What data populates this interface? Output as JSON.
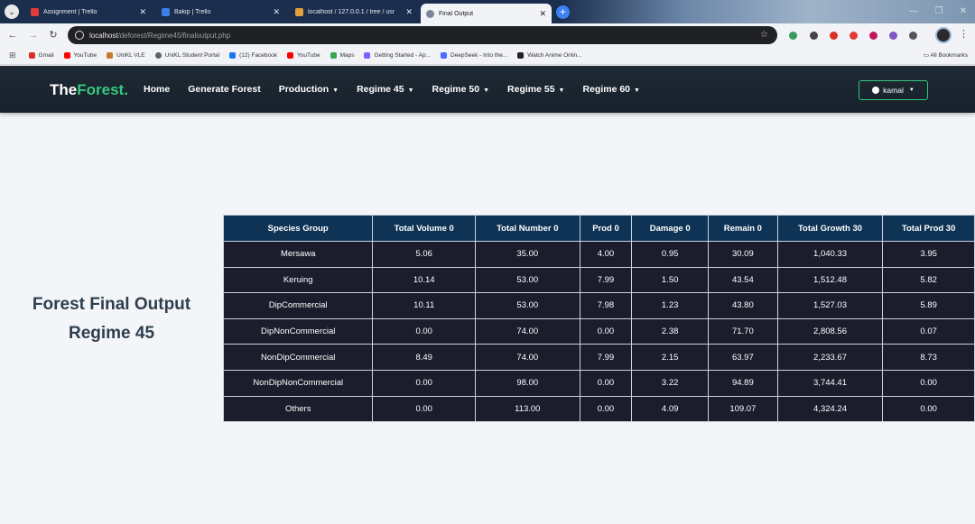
{
  "browser": {
    "tabs": [
      {
        "title": "Assignment | Trello",
        "favicon_color": "#e03c3c"
      },
      {
        "title": "Bakip | Trello",
        "favicon_color": "#3f7ee8"
      },
      {
        "title": "localhost / 127.0.0.1 / tree / usr",
        "favicon_color": "#e2a03f"
      },
      {
        "title": "Final Output",
        "favicon_color": "#7a8899"
      }
    ],
    "new_tab_label": "+",
    "url_host": "localhost",
    "url_path": "/deforest/Regime45/finaloutput.php",
    "bookmarks": [
      {
        "label": "Gmail",
        "color": "#d93025"
      },
      {
        "label": "YouTube",
        "color": "#ff0000"
      },
      {
        "label": "UniKL VLE",
        "color": "#c47a2c"
      },
      {
        "label": "UniKL Student Portal",
        "color": "#5f6368"
      },
      {
        "label": "(12) Facebook",
        "color": "#1877f2"
      },
      {
        "label": "YouTube",
        "color": "#ff0000"
      },
      {
        "label": "Maps",
        "color": "#34a853"
      },
      {
        "label": "Getting Started - Ap...",
        "color": "#7b61ff"
      },
      {
        "label": "DeepSeek - Into the...",
        "color": "#4d6bfe"
      },
      {
        "label": "Watch Anime Onlin...",
        "color": "#222222"
      }
    ],
    "all_bookmarks_label": "All Bookmarks"
  },
  "navbar": {
    "brand_main": "The",
    "brand_accent": "Forest.",
    "accent_color": "#34c97b",
    "items": [
      {
        "label": "Home",
        "dropdown": false
      },
      {
        "label": "Generate Forest",
        "dropdown": false
      },
      {
        "label": "Production",
        "dropdown": true
      },
      {
        "label": "Regime 45",
        "dropdown": true
      },
      {
        "label": "Regime 50",
        "dropdown": true
      },
      {
        "label": "Regime 55",
        "dropdown": true
      },
      {
        "label": "Regime 60",
        "dropdown": true
      }
    ],
    "user_label": "kamal"
  },
  "page": {
    "title_line1": "Forest Final Output",
    "title_line2": "Regime 45"
  },
  "table": {
    "columns": [
      "Species Group",
      "Total Volume 0",
      "Total Number 0",
      "Prod 0",
      "Damage 0",
      "Remain 0",
      "Total Growth 30",
      "Total Prod 30"
    ],
    "rows": [
      [
        "Mersawa",
        "5.06",
        "35.00",
        "4.00",
        "0.95",
        "30.09",
        "1,040.33",
        "3.95"
      ],
      [
        "Keruing",
        "10.14",
        "53.00",
        "7.99",
        "1.50",
        "43.54",
        "1,512.48",
        "5.82"
      ],
      [
        "DipCommercial",
        "10.11",
        "53.00",
        "7.98",
        "1.23",
        "43.80",
        "1,527.03",
        "5.89"
      ],
      [
        "DipNonCommercial",
        "0.00",
        "74.00",
        "0.00",
        "2.38",
        "71.70",
        "2,808.56",
        "0.07"
      ],
      [
        "NonDipCommercial",
        "8.49",
        "74.00",
        "7.99",
        "2.15",
        "63.97",
        "2,233.67",
        "8.73"
      ],
      [
        "NonDipNonCommercial",
        "0.00",
        "98.00",
        "0.00",
        "3.22",
        "94.89",
        "3,744.41",
        "0.00"
      ],
      [
        "Others",
        "0.00",
        "113.00",
        "0.00",
        "4.09",
        "109.07",
        "4,324.24",
        "0.00"
      ]
    ]
  }
}
